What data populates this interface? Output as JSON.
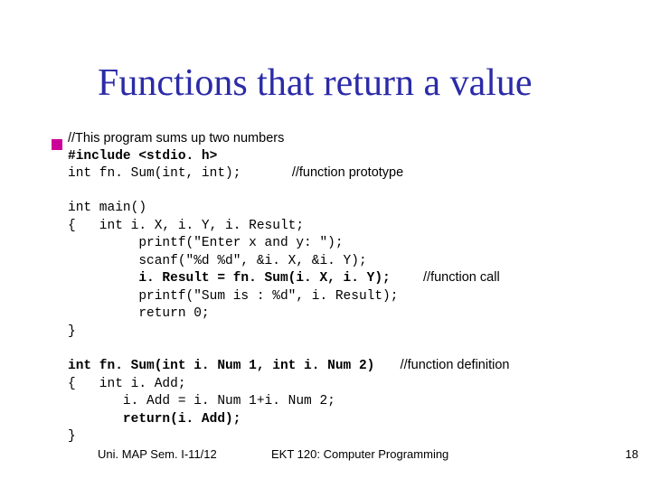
{
  "title": "Functions that return a value",
  "comment1": "//This program sums up two numbers",
  "include_line": "#include <stdio. h>",
  "proto_code": "int fn. Sum(int, int);",
  "proto_comment": "//function prototype",
  "main_open": "int main()",
  "main_brace_decl": "{   int i. X, i. Y, i. Result;",
  "printf1": "         printf(\"Enter x and y: \");",
  "scanf1": "         scanf(\"%d %d\", &i. X, &i. Y);",
  "call_code": "         i. Result = fn. Sum(i. X, i. Y);",
  "call_comment": "//function call",
  "printf2": "         printf(\"Sum is : %d\", i. Result);",
  "ret0": "         return 0;",
  "main_close": "}",
  "fn_def_sig": "int fn. Sum(int i. Num 1, int i. Num 2)",
  "fn_def_comment": "//function definition",
  "fn_def_decl": "{   int i. Add;",
  "fn_def_assign": "       i. Add = i. Num 1+i. Num 2;",
  "fn_def_ret": "       return(i. Add);",
  "fn_def_close": "}",
  "footer_left": "Uni. MAP Sem. I-11/12",
  "footer_center": "EKT 120: Computer Programming",
  "page_num": "18"
}
